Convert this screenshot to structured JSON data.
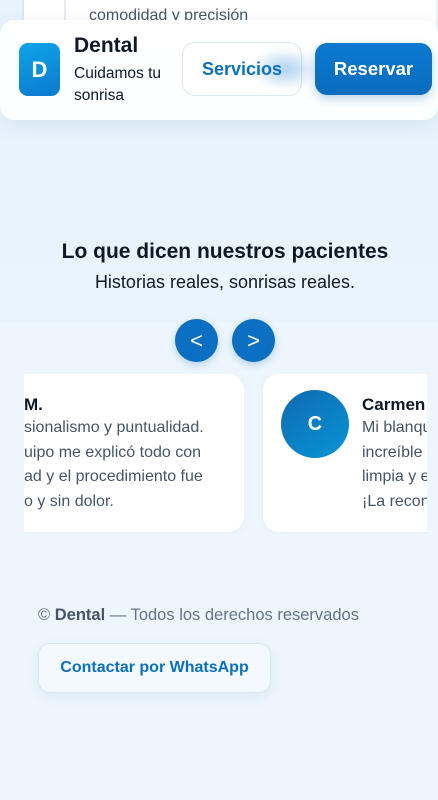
{
  "previous_section": {
    "peek_text": "comodidad y precisión"
  },
  "header": {
    "logo_letter": "D",
    "brand_name": "Dental",
    "tagline": "Cuidamos tu sonrisa",
    "services_label": "Servicios",
    "book_label": "Reservar"
  },
  "testimonials": {
    "title": "Lo que dicen nuestros pacientes",
    "subtitle": "Historias reales, sonrisas reales.",
    "prev_label": "<",
    "next_label": ">",
    "items": [
      {
        "name": "M.",
        "lines": [
          "sionalismo y puntualidad.",
          "uipo me explicó todo con",
          "ad y el procedimiento fue",
          "o y sin dolor."
        ]
      },
      {
        "initial": "C",
        "name": "Carmen",
        "lines": [
          "Mi blanqu",
          "increíble",
          "limpia y e",
          "¡La recon"
        ]
      }
    ]
  },
  "footer": {
    "copyright_symbol": "©",
    "brand": "Dental",
    "rights_text": "— Todos los derechos reservados",
    "whatsapp_label": "Contactar por WhatsApp"
  },
  "colors": {
    "primary": "#0b6fc2",
    "background": "#eef6fd",
    "text_dark": "#0f172a",
    "text_muted": "#475569"
  }
}
